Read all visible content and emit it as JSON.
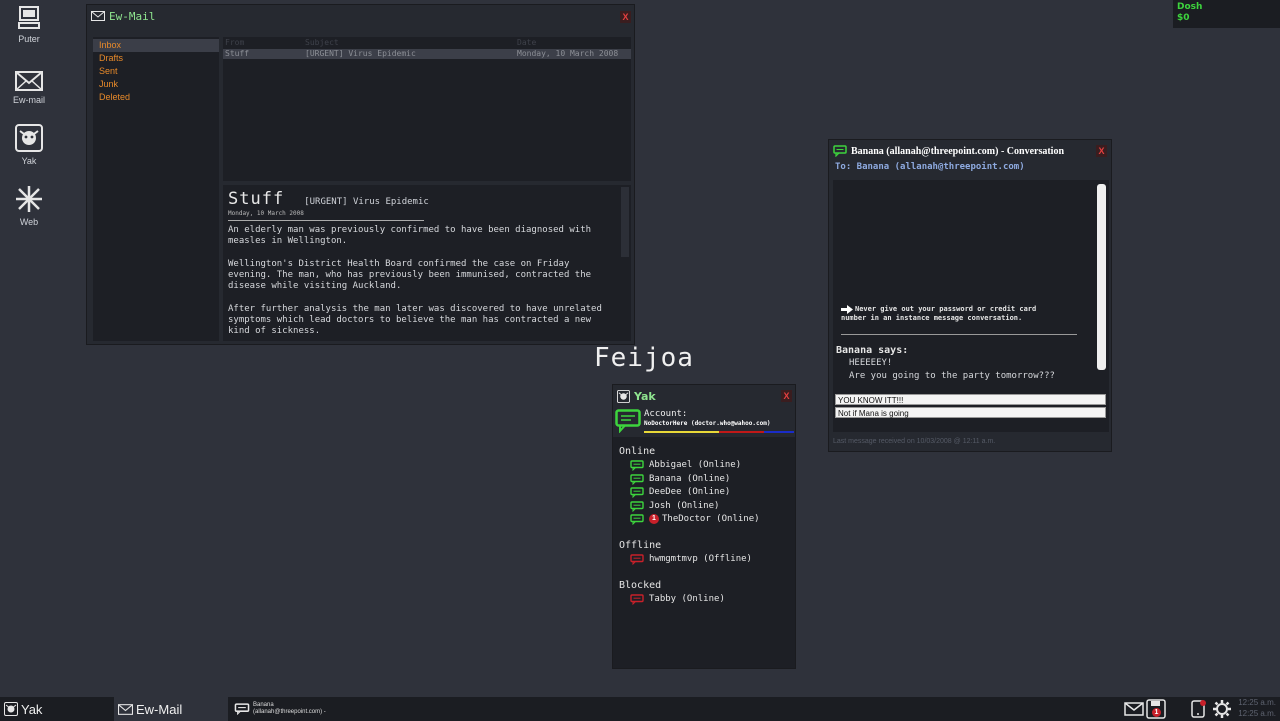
{
  "desktop": {
    "icons": [
      {
        "label": "Puter",
        "icon": "computer-icon"
      },
      {
        "label": "Ew-mail",
        "icon": "envelope-icon"
      },
      {
        "label": "Yak",
        "icon": "yak-icon"
      },
      {
        "label": "Web",
        "icon": "web-icon"
      }
    ]
  },
  "dosh": {
    "label": "Dosh",
    "value": "$0"
  },
  "email": {
    "title": "Ew-Mail",
    "close_label": "X",
    "folders": [
      "Inbox",
      "Drafts",
      "Sent",
      "Junk",
      "Deleted"
    ],
    "list": {
      "columns": [
        "From",
        "Subject",
        "Date"
      ],
      "rows": [
        {
          "from": "Stuff",
          "subject": "[URGENT] Virus Epidemic",
          "date": "Monday, 10 March 2008"
        }
      ]
    },
    "message": {
      "from": "Stuff",
      "subject": "[URGENT] Virus Epidemic",
      "date": "Monday, 10 March 2008",
      "paragraphs": [
        "An elderly man was previously confirmed to have been diagnosed with measles in Wellington.",
        "Wellington's District Health Board confirmed the case on Friday evening. The man, who has previously been immunised, contracted the disease while visiting Auckland.",
        "After further analysis the man later was discovered to have unrelated symptoms which lead doctors to believe the man has contracted a new kind of sickness."
      ]
    }
  },
  "conversation": {
    "title": "Banana (allanah@threepoint.com) - Conversation",
    "close_label": "X",
    "to": "To: Banana (allanah@threepoint.com)",
    "warning_line1": "Never give out your password or credit card",
    "warning_line2": "number in an instance message conversation.",
    "says": "Banana says:",
    "messages": [
      "HEEEEEY!",
      "Are you going to the party tomorrow???"
    ],
    "replies": [
      "YOU KNOW ITT!!!",
      "Not if Mana is going"
    ],
    "status": "Last message received on 10/03/2008 @ 12:11 a.m."
  },
  "floating_label": "Feijoa",
  "yak": {
    "title": "Yak",
    "close_label": "X",
    "account_label": "Account:",
    "account_name": "NoDoctorHere (doctor.who@wahoo.com)",
    "sections": {
      "online": "Online",
      "offline": "Offline",
      "blocked": "Blocked"
    },
    "online": [
      {
        "name": "Abbigael (Online)"
      },
      {
        "name": "Banana (Online)"
      },
      {
        "name": "DeeDee (Online)"
      },
      {
        "name": "Josh (Online)"
      },
      {
        "name": "TheDoctor (Online)",
        "badge": "1"
      }
    ],
    "offline": [
      {
        "name": "hwmgmtmvp (Offline)"
      }
    ],
    "blocked": [
      {
        "name": "Tabby (Online)"
      }
    ]
  },
  "taskbar": {
    "items": [
      "Yak",
      "Ew-Mail"
    ],
    "convo_line1": "Banana",
    "convo_line2": "(allanah@threepoint.com) -",
    "tray_badge": "1",
    "clock1": "12:25 a.m.",
    "clock2": "12:25 a.m."
  },
  "colors": {
    "accent_green": "#8fe58f",
    "folder_orange": "#e88a2a",
    "online_green": "#3dd43d",
    "offline_red": "#c8202a"
  }
}
